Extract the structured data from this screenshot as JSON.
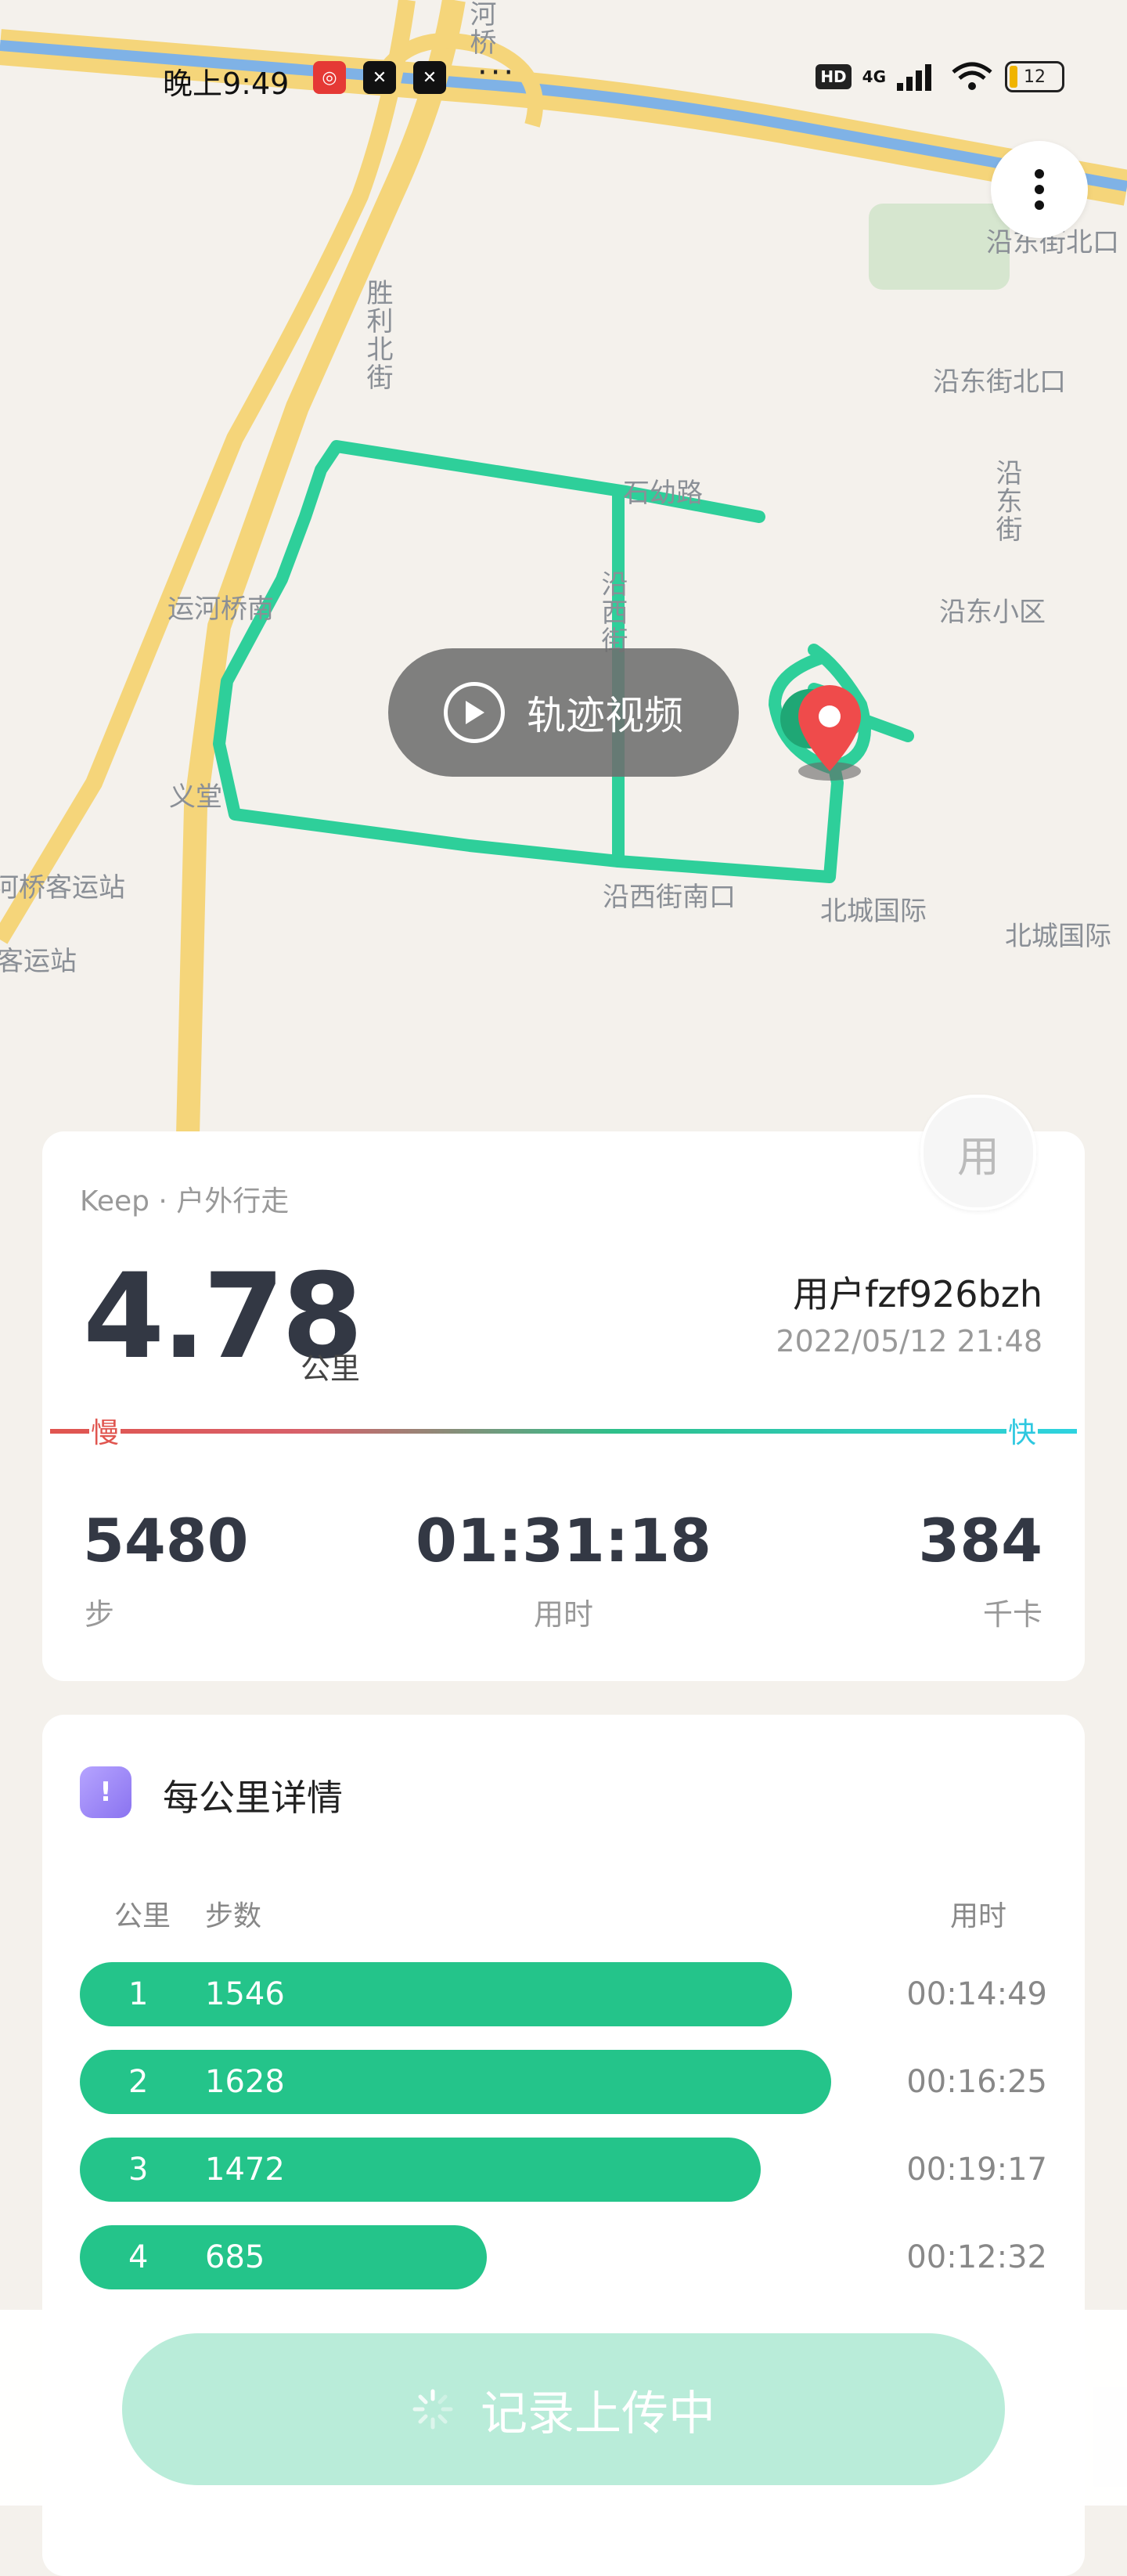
{
  "status_bar": {
    "time": "晚上9:49",
    "dots": "···",
    "hd": "HD",
    "network": "4G",
    "battery": "12"
  },
  "map": {
    "labels": [
      "胜利北街",
      "运河桥南",
      "义堂",
      "河桥客运站",
      "客运站",
      "沿东街北口",
      "沿东街北口",
      "沿东街",
      "沿东小区",
      "沿西街南口",
      "北城国际",
      "北城国际",
      "沿西街",
      "石幼路",
      "河桥"
    ],
    "video_button": "轨迹视频"
  },
  "summary": {
    "source": "Keep · 户外行走",
    "distance": "4.78",
    "distance_unit": "公里",
    "username": "用户fzf926bzh",
    "datetime": "2022/05/12 21:48",
    "avatar_char": "用",
    "slow_label": "慢",
    "fast_label": "快",
    "stats": [
      {
        "value": "5480",
        "label": "步"
      },
      {
        "value": "01:31:18",
        "label": "用时"
      },
      {
        "value": "384",
        "label": "千卡"
      }
    ]
  },
  "per_km": {
    "title": "每公里详情",
    "icon_char": "!",
    "headers": {
      "km": "公里",
      "steps": "步数",
      "time": "用时"
    },
    "rows": [
      {
        "km": "1",
        "steps": "1546",
        "time": "00:14:49",
        "fill": 0.91
      },
      {
        "km": "2",
        "steps": "1628",
        "time": "00:16:25",
        "fill": 0.96
      },
      {
        "km": "3",
        "steps": "1472",
        "time": "00:19:17",
        "fill": 0.87
      },
      {
        "km": "4",
        "steps": "685",
        "time": "00:12:32",
        "fill": 0.52
      }
    ]
  },
  "upload_button": "记录上传中",
  "colors": {
    "track": "#2ecf9a",
    "bar": "#24c48a",
    "upload": "#b9ecd9"
  }
}
